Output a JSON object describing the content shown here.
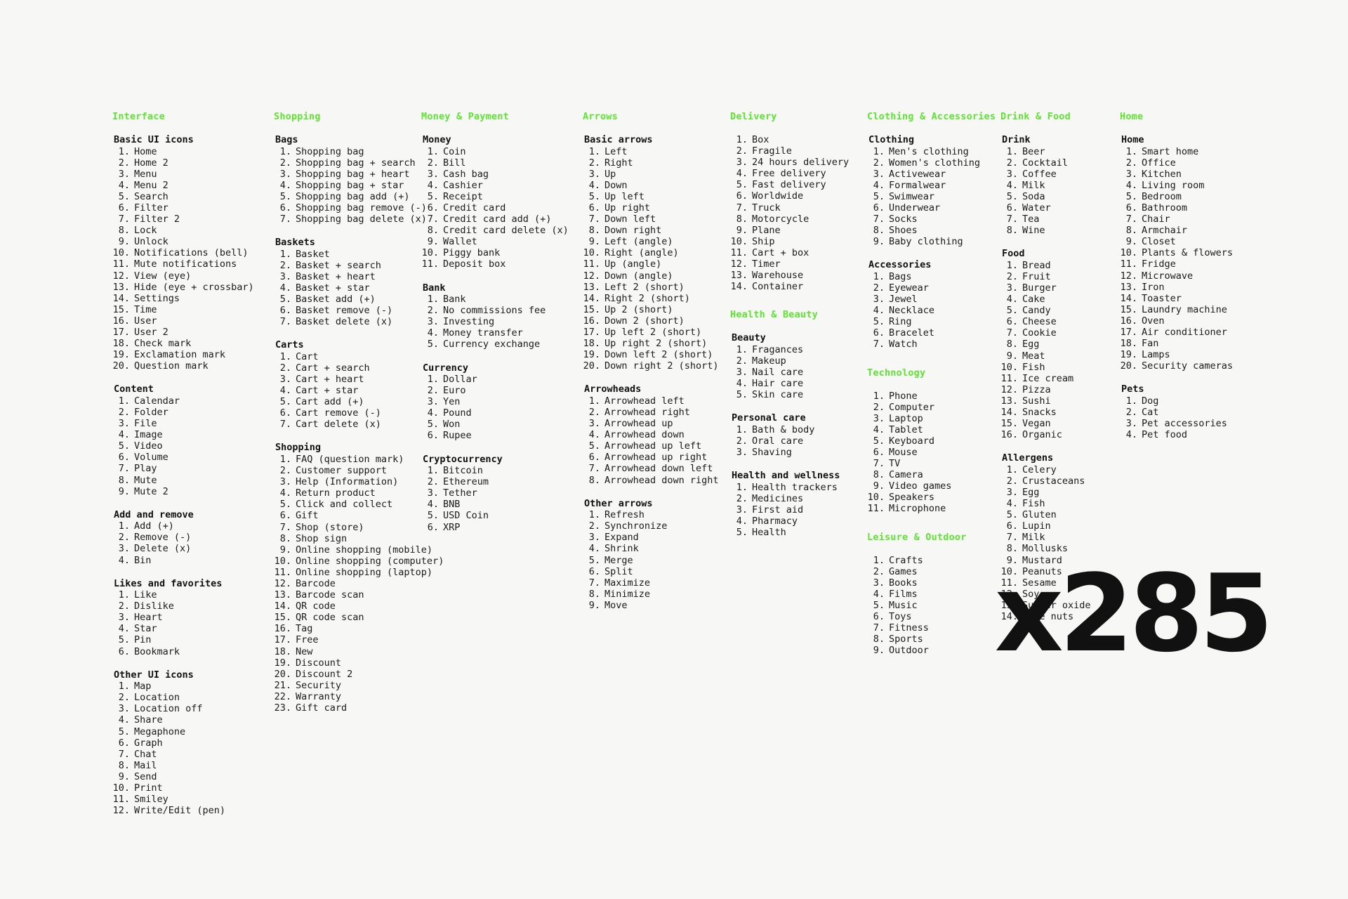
{
  "page": {
    "background_color": "#f7f7f5",
    "accent_color": "#5ee432",
    "text_color": "#1a1a1a",
    "total_badge": "x285"
  },
  "columns": [
    {
      "name": "interface",
      "width_class": "col-w-230",
      "sections": [
        {
          "category": "Interface",
          "groups": [
            {
              "title": "Basic UI icons",
              "items": [
                "Home",
                "Home 2",
                "Menu",
                "Menu 2",
                "Search",
                "Filter",
                "Filter 2",
                "Lock",
                "Unlock",
                "Notifications (bell)",
                "Mute notifications",
                "View (eye)",
                "Hide (eye + crossbar)",
                "Settings",
                "Time",
                "User",
                "User 2",
                "Check mark",
                "Exclamation mark",
                "Question mark"
              ]
            },
            {
              "title": "Content",
              "items": [
                "Calendar",
                "Folder",
                "File",
                "Image",
                "Video",
                "Volume",
                "Play",
                "Mute",
                "Mute 2"
              ]
            },
            {
              "title": "Add and remove",
              "items": [
                "Add (+)",
                "Remove (-)",
                "Delete (x)",
                "Bin"
              ]
            },
            {
              "title": "Likes and favorites",
              "items": [
                "Like",
                "Dislike",
                "Heart",
                "Star",
                "Pin",
                "Bookmark"
              ]
            },
            {
              "title": "Other UI icons",
              "items": [
                "Map",
                "Location",
                "Location off",
                "Share",
                "Megaphone",
                "Graph",
                "Chat",
                "Mail",
                "Send",
                "Print",
                "Smiley",
                "Write/Edit (pen)"
              ]
            }
          ]
        }
      ]
    },
    {
      "name": "shopping",
      "width_class": "col-w-210",
      "sections": [
        {
          "category": "Shopping",
          "groups": [
            {
              "title": "Bags",
              "items": [
                "Shopping bag",
                "Shopping bag + search",
                "Shopping bag + heart",
                "Shopping bag + star",
                "Shopping bag add (+)",
                "Shopping bag remove (-)",
                "Shopping bag delete (x)"
              ]
            },
            {
              "title": "Baskets",
              "items": [
                "Basket",
                "Basket + search",
                "Basket + heart",
                "Basket + star",
                "Basket add (+)",
                "Basket remove (-)",
                "Basket delete (x)"
              ]
            },
            {
              "title": "Carts",
              "items": [
                "Cart",
                "Cart + search",
                "Cart + heart",
                "Cart + star",
                "Cart add (+)",
                "Cart remove (-)",
                "Cart delete (x)"
              ]
            },
            {
              "title": "Shopping",
              "items": [
                "FAQ (question mark)",
                "Customer support",
                "Help (Information)",
                "Return product",
                "Click and collect",
                "Gift",
                "Shop (store)",
                "Shop sign",
                "Online shopping (mobile)",
                "Online shopping (computer)",
                "Online shopping (laptop)",
                "Barcode",
                "Barcode scan",
                "QR code",
                "QR code scan",
                "Tag",
                "Free",
                "New",
                "Discount",
                "Discount 2",
                "Security",
                "Warranty",
                "Gift card"
              ]
            }
          ]
        }
      ]
    },
    {
      "name": "money-payment",
      "width_class": "col-w-230",
      "sections": [
        {
          "category": "Money & Payment",
          "groups": [
            {
              "title": "Money",
              "items": [
                "Coin",
                "Bill",
                "Cash bag",
                "Cashier",
                "Receipt",
                "Credit card",
                "Credit card add (+)",
                "Credit card delete (x)",
                "Wallet",
                "Piggy bank",
                "Deposit box"
              ]
            },
            {
              "title": "Bank",
              "items": [
                "Bank",
                "No commissions fee",
                "Investing",
                "Money transfer",
                "Currency exchange"
              ]
            },
            {
              "title": "Currency",
              "items": [
                "Dollar",
                "Euro",
                "Yen",
                "Pound",
                "Won",
                "Rupee"
              ]
            },
            {
              "title": "Cryptocurrency",
              "items": [
                "Bitcoin",
                "Ethereum",
                "Tether",
                "BNB",
                "USD Coin",
                "XRP"
              ]
            }
          ]
        }
      ]
    },
    {
      "name": "arrows",
      "width_class": "col-w-210",
      "sections": [
        {
          "category": "Arrows",
          "groups": [
            {
              "title": "Basic arrows",
              "items": [
                "Left",
                "Right",
                "Up",
                "Down",
                "Up left",
                "Up right",
                "Down left",
                "Down right",
                "Left (angle)",
                "Right (angle)",
                "Up (angle)",
                "Down (angle)",
                "Left 2 (short)",
                "Right 2 (short)",
                "Up 2 (short)",
                "Down 2 (short)",
                "Up left 2 (short)",
                "Up right 2 (short)",
                "Down left 2 (short)",
                "Down right 2 (short)"
              ]
            },
            {
              "title": "Arrowheads",
              "items": [
                "Arrowhead left",
                "Arrowhead right",
                "Arrowhead up",
                "Arrowhead down",
                "Arrowhead up left",
                "Arrowhead up right",
                "Arrowhead down left",
                "Arrowhead down right"
              ]
            },
            {
              "title": "Other arrows",
              "items": [
                "Refresh",
                "Synchronize",
                "Expand",
                "Shrink",
                "Merge",
                "Split",
                "Maximize",
                "Minimize",
                "Move"
              ]
            }
          ]
        }
      ]
    },
    {
      "name": "delivery-health",
      "width_class": "col-w-195",
      "sections": [
        {
          "category": "Delivery",
          "groups": [
            {
              "title": "",
              "items": [
                "Box",
                "Fragile",
                "24 hours delivery",
                "Free delivery",
                "Fast delivery",
                "Worldwide",
                "Truck",
                "Motorcycle",
                "Plane",
                "Ship",
                "Cart + box",
                "Timer",
                "Warehouse",
                "Container"
              ]
            }
          ]
        },
        {
          "category": "Health & Beauty",
          "groups": [
            {
              "title": "Beauty",
              "items": [
                "Fragances",
                "Makeup",
                "Nail care",
                "Hair care",
                "Skin care"
              ]
            },
            {
              "title": "Personal care",
              "items": [
                "Bath & body",
                "Oral care",
                "Shaving"
              ]
            },
            {
              "title": "Health and wellness",
              "items": [
                "Health trackers",
                "Medicines",
                "First aid",
                "Pharmacy",
                "Health"
              ]
            }
          ]
        }
      ]
    },
    {
      "name": "clothing-technology-leisure",
      "width_class": "col-w-190",
      "sections": [
        {
          "category": "Clothing & Accessories",
          "groups": [
            {
              "title": "Clothing",
              "items": [
                "Men's clothing",
                "Women's clothing",
                "Activewear",
                "Formalwear",
                "Swimwear",
                "Underwear",
                "Socks",
                "Shoes",
                "Baby clothing"
              ]
            },
            {
              "title": "Accessories",
              "items": [
                "Bags",
                "Eyewear",
                "Jewel",
                "Necklace",
                "Ring",
                "Bracelet",
                "Watch"
              ]
            }
          ]
        },
        {
          "category": "Technology",
          "groups": [
            {
              "title": "",
              "items": [
                "Phone",
                "Computer",
                "Laptop",
                "Tablet",
                "Keyboard",
                "Mouse",
                "TV",
                "Camera",
                "Video games",
                "Speakers",
                "Microphone"
              ]
            }
          ]
        },
        {
          "category": "Leisure & Outdoor",
          "groups": [
            {
              "title": "",
              "items": [
                "Crafts",
                "Games",
                "Books",
                "Films",
                "Music",
                "Toys",
                "Fitness",
                "Sports",
                "Outdoor"
              ]
            }
          ]
        }
      ]
    },
    {
      "name": "drink-food",
      "width_class": "col-w-170",
      "sections": [
        {
          "category": "Drink & Food",
          "groups": [
            {
              "title": "Drink",
              "items": [
                "Beer",
                "Cocktail",
                "Coffee",
                "Milk",
                "Soda",
                "Water",
                "Tea",
                "Wine"
              ]
            },
            {
              "title": "Food",
              "items": [
                "Bread",
                "Fruit",
                "Burger",
                "Cake",
                "Candy",
                "Cheese",
                "Cookie",
                "Egg",
                "Meat",
                "Fish",
                "Ice cream",
                "Pizza",
                "Sushi",
                "Snacks",
                "Vegan",
                "Organic"
              ]
            },
            {
              "title": "Allergens",
              "items": [
                "Celery",
                "Crustaceans",
                "Egg",
                "Fish",
                "Gluten",
                "Lupin",
                "Milk",
                "Mollusks",
                "Mustard",
                "Peanuts",
                "Sesame",
                "Soy",
                "Sulfur oxide",
                "Tree nuts"
              ]
            }
          ]
        }
      ]
    },
    {
      "name": "home",
      "width_class": "col-w-165",
      "sections": [
        {
          "category": "Home",
          "groups": [
            {
              "title": "Home",
              "items": [
                "Smart home",
                "Office",
                "Kitchen",
                "Living room",
                "Bedroom",
                "Bathroom",
                "Chair",
                "Armchair",
                "Closet",
                "Plants & flowers",
                "Fridge",
                "Microwave",
                "Iron",
                "Toaster",
                "Laundry machine",
                "Oven",
                "Air conditioner",
                "Fan",
                "Lamps",
                "Security cameras"
              ]
            },
            {
              "title": "Pets",
              "items": [
                "Dog",
                "Cat",
                "Pet accessories",
                "Pet food"
              ]
            }
          ]
        }
      ]
    }
  ]
}
